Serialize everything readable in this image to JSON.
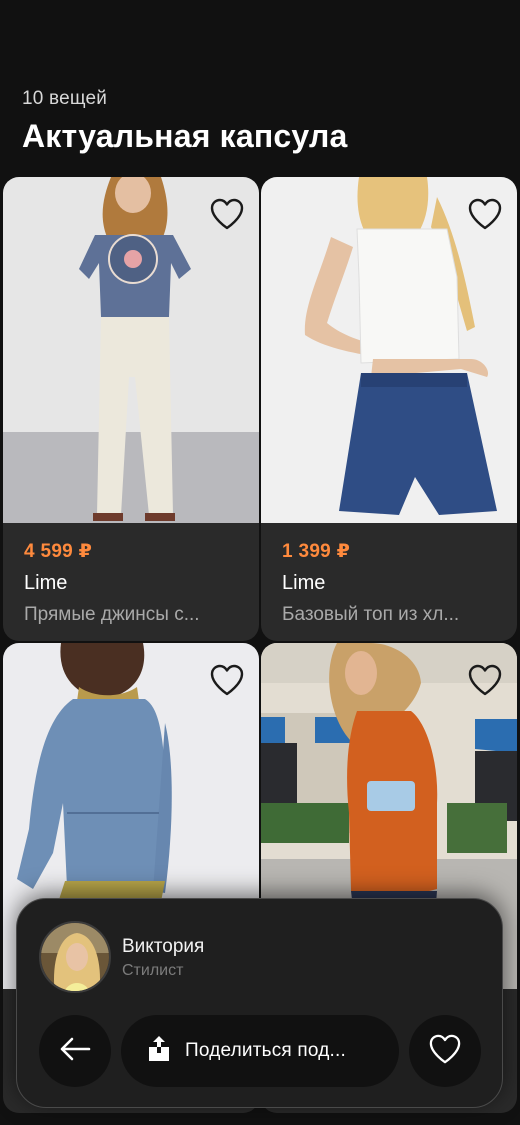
{
  "header": {
    "count": "10 вещей",
    "title": "Актуальная капсула"
  },
  "products": [
    {
      "price": "4 599 ₽",
      "brand": "Lime",
      "desc": "Прямые джинсы с...",
      "photo_icon": "product-photo-jeans"
    },
    {
      "price": "1 399 ₽",
      "brand": "Lime",
      "desc": "Базовый топ из хл...",
      "photo_icon": "product-photo-tank-top"
    },
    {
      "price": "",
      "brand": "",
      "desc": "",
      "photo_icon": "product-photo-denim-jacket"
    },
    {
      "price": "",
      "brand": "",
      "desc": "",
      "photo_icon": "product-photo-orange-knit"
    }
  ],
  "stylist": {
    "name": "Виктория",
    "role": "Стилист"
  },
  "actions": {
    "back_icon": "arrow-left-icon",
    "share_icon": "share-icon",
    "share_label": "Поделиться под...",
    "like_icon": "heart-icon"
  },
  "colors": {
    "background": "#111111",
    "card": "#2a2a2a",
    "price": "#ff8a3d",
    "muted": "#a9a9a9"
  }
}
